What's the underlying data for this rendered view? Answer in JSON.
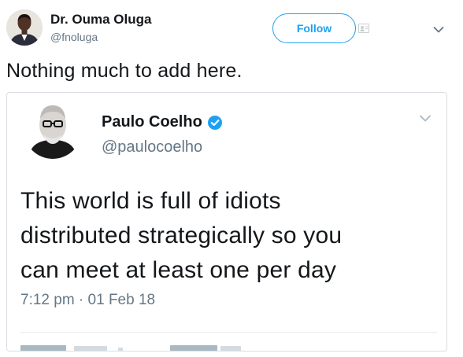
{
  "header": {
    "author_name": "Dr. Ouma Oluga",
    "author_handle": "@fnoluga",
    "follow_label": "Follow"
  },
  "tweet": {
    "text": "Nothing much to add here."
  },
  "quoted_tweet": {
    "author_name": "Paulo Coelho",
    "author_handle": "@paulocoelho",
    "text_lines": [
      "This world is full of idiots",
      "distributed strategically so you",
      "can meet at least one per day"
    ],
    "timestamp": "7:12 pm · 01 Feb 18"
  },
  "icons": {
    "avatar": "person-avatar-icon",
    "follow_extra": "add-user-icon",
    "menu": "chevron-down-icon",
    "verified": "verified-badge-icon"
  },
  "colors": {
    "accent": "#1da1f2",
    "text_primary": "#14171a",
    "text_secondary": "#657786",
    "border": "#d9dee2"
  }
}
